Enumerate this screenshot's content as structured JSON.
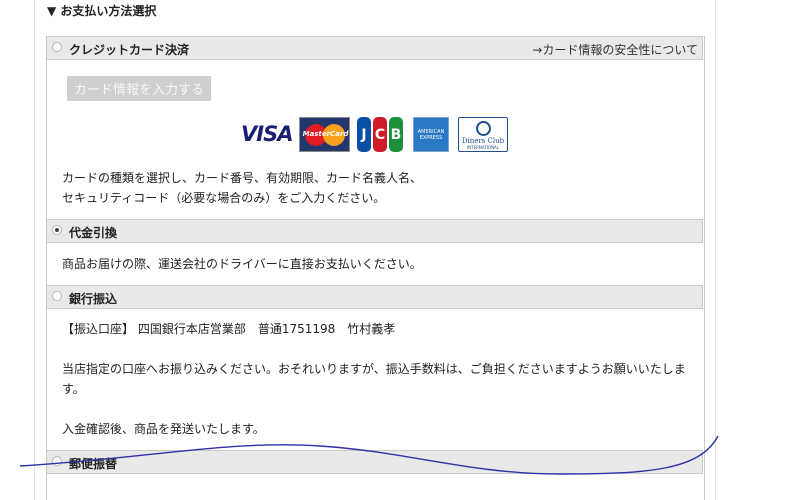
{
  "section_title": "▼ お支払い方法選択",
  "credit": {
    "label": "クレジットカード決済",
    "safety_link": "→カード情報の安全性について",
    "input_button": "カード情報を入力する",
    "brands": {
      "visa": "VISA",
      "mastercard": "MasterCard",
      "jcb": [
        "J",
        "C",
        "B"
      ],
      "amex": "AMERICAN EXPRESS",
      "diners": "Diners Club",
      "diners_sub": "INTERNATIONAL"
    },
    "desc_line1": "カードの種類を選択し、カード番号、有効期限、カード名義人名、",
    "desc_line2": "セキュリティコード（必要な場合のみ）をご入力ください。"
  },
  "cod": {
    "label": "代金引換",
    "selected": true,
    "desc": "商品お届けの際、運送会社のドライバーに直接お支払いください。"
  },
  "bank": {
    "label": "銀行振込",
    "account": "【振込口座】 四国銀行本店営業部　普通1751198　竹村義孝",
    "note_line1": "当店指定の口座へお振り込みください。おそれいりますが、振込手数料は、ご負担くださいますようお願いいたしま",
    "note_line2": "す。",
    "shipping_note": "入金確認後、商品を発送いたします。"
  },
  "postal": {
    "label": "郵便振替"
  },
  "colors": {
    "header_bg": "#e9e9e9",
    "border": "#c9c9c9",
    "button_bg": "#cfcfcf",
    "annotation_line": "#2a33a8"
  }
}
